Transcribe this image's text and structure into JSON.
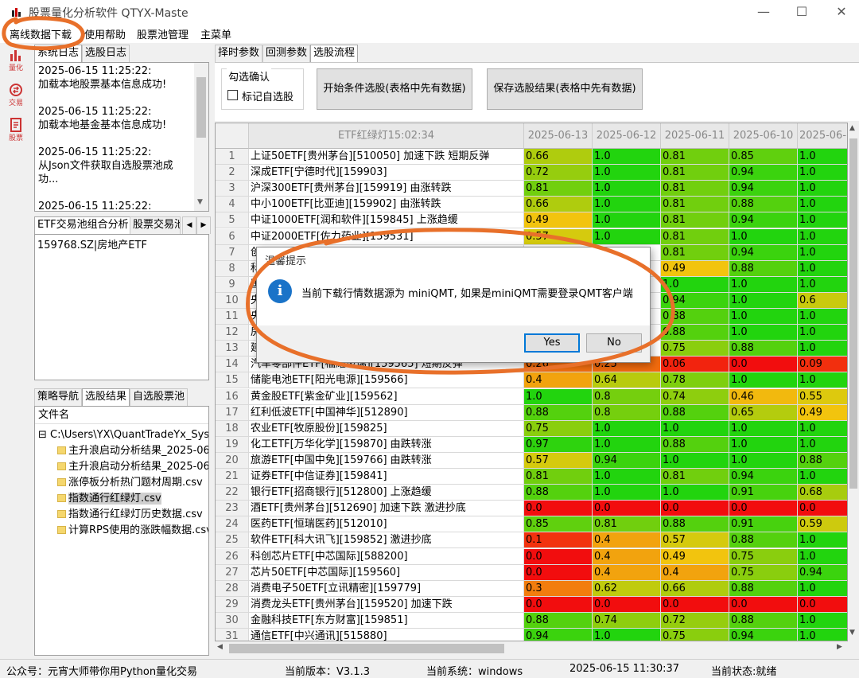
{
  "window": {
    "title": "股票量化分析软件 QTYX-Maste",
    "minimize": "—",
    "maximize": "☐",
    "close": "✕"
  },
  "menubar": {
    "items": [
      "离线数据下载",
      "使用帮助",
      "股票池管理",
      "主菜单"
    ]
  },
  "leftstrip": {
    "items": [
      {
        "label": "量化",
        "icon": "bar-chart-icon"
      },
      {
        "label": "交易",
        "icon": "exchange-icon"
      },
      {
        "label": "股票",
        "icon": "document-icon"
      }
    ]
  },
  "log_panel": {
    "tabs": [
      "系统日志",
      "选股日志"
    ],
    "text": "2025-06-15 11:25:22:\n加载本地股票基本信息成功!\n\n2025-06-15 11:25:22:\n加载本地基金基本信息成功!\n\n2025-06-15 11:25:22:\n从Json文件获取自选股票池成功...\n\n2025-06-15 11:25:22:"
  },
  "etf_panel": {
    "tabs": [
      "ETF交易池组合分析",
      "股票交易池"
    ],
    "items": [
      "159768.SZ|房地产ETF"
    ],
    "arrow_left": "◀",
    "arrow_right": "▶"
  },
  "strategy_panel": {
    "tabs": [
      "策略导航",
      "选股结果",
      "自选股票池"
    ],
    "column_header": "文件名",
    "root": "C:\\Users\\YX\\QuantTradeYx_System",
    "expander": "⊟",
    "files": [
      "主升浪启动分析结果_2025-06",
      "主升浪启动分析结果_2025-06",
      "涨停板分析热门题材周期.csv",
      "指数通行红绿灯.csv",
      "指数通行红绿灯历史数据.csv",
      "计算RPS使用的涨跌幅数据.csv"
    ],
    "selected_index": 3
  },
  "right_tabs": [
    "择时参数",
    "回测参数",
    "选股流程"
  ],
  "controls": {
    "group_title": "勾选确认",
    "checkbox_label": "标记自选股",
    "checkbox_checked": false,
    "btn_start": "开始条件选股(表格中先有数据)",
    "btn_save": "保存选股结果(表格中先有数据)"
  },
  "table": {
    "header_name": "ETF红绿灯15:02:34",
    "dates": [
      "2025-06-13",
      "2025-06-12",
      "2025-06-11",
      "2025-06-10",
      "2025-06-"
    ],
    "rows": [
      {
        "n": "1",
        "name": "上证50ETF[贵州茅台][510050] 加速下跌 短期反弹",
        "v": [
          "0.66",
          "1.0",
          "0.81",
          "0.85",
          "1.0"
        ]
      },
      {
        "n": "2",
        "name": "深成ETF[宁德时代][159903]",
        "v": [
          "0.72",
          "1.0",
          "0.81",
          "0.94",
          "1.0"
        ]
      },
      {
        "n": "3",
        "name": "沪深300ETF[贵州茅台][159919] 由涨转跌",
        "v": [
          "0.81",
          "1.0",
          "0.81",
          "0.94",
          "1.0"
        ]
      },
      {
        "n": "4",
        "name": "中小100ETF[比亚迪][159902] 由涨转跌",
        "v": [
          "0.66",
          "1.0",
          "0.81",
          "0.88",
          "1.0"
        ]
      },
      {
        "n": "5",
        "name": "中证1000ETF[润和软件][159845] 上涨趋缓",
        "v": [
          "0.49",
          "1.0",
          "0.81",
          "0.94",
          "1.0"
        ]
      },
      {
        "n": "6",
        "name": "中证2000ETF[佐力药业][159531]",
        "v": [
          "0.57",
          "1.0",
          "0.81",
          "1.0",
          "1.0"
        ]
      },
      {
        "n": "7",
        "name": "创",
        "v": [
          "",
          "",
          "0.81",
          "0.94",
          "1.0"
        ]
      },
      {
        "n": "8",
        "name": "科",
        "v": [
          "",
          "",
          "0.49",
          "0.88",
          "1.0"
        ]
      },
      {
        "n": "9",
        "name": "国",
        "v": [
          "",
          "",
          "1.0",
          "1.0",
          "1.0"
        ]
      },
      {
        "n": "10",
        "name": "央",
        "v": [
          "",
          "",
          "0.94",
          "1.0",
          "0.6"
        ]
      },
      {
        "n": "11",
        "name": "央",
        "v": [
          "",
          "",
          "0.88",
          "1.0",
          "1.0"
        ]
      },
      {
        "n": "12",
        "name": "房",
        "v": [
          "",
          "",
          "0.88",
          "1.0",
          "1.0"
        ]
      },
      {
        "n": "13",
        "name": "建",
        "v": [
          "",
          "",
          "0.75",
          "0.88",
          "1.0"
        ]
      },
      {
        "n": "14",
        "name": "汽车零部件ETF[福耀玻璃][159565] 短期反弹",
        "v": [
          "0.26",
          "0.25",
          "0.06",
          "0.0",
          "0.09"
        ]
      },
      {
        "n": "15",
        "name": "储能电池ETF[阳光电源][159566]",
        "v": [
          "0.4",
          "0.64",
          "0.78",
          "1.0",
          "1.0"
        ]
      },
      {
        "n": "16",
        "name": "黄金股ETF[紫金矿业][159562]",
        "v": [
          "1.0",
          "0.8",
          "0.74",
          "0.46",
          "0.55"
        ]
      },
      {
        "n": "17",
        "name": "红利低波ETF[中国神华][512890]",
        "v": [
          "0.88",
          "0.8",
          "0.88",
          "0.65",
          "0.49"
        ]
      },
      {
        "n": "18",
        "name": "农业ETF[牧原股份][159825]",
        "v": [
          "0.75",
          "1.0",
          "1.0",
          "1.0",
          "1.0"
        ]
      },
      {
        "n": "19",
        "name": "化工ETF[万华化学][159870] 由跌转涨",
        "v": [
          "0.97",
          "1.0",
          "0.88",
          "1.0",
          "1.0"
        ]
      },
      {
        "n": "20",
        "name": "旅游ETF[中国中免][159766] 由跌转涨",
        "v": [
          "0.57",
          "0.94",
          "1.0",
          "1.0",
          "0.88"
        ]
      },
      {
        "n": "21",
        "name": "证券ETF[中信证券][159841]",
        "v": [
          "0.81",
          "1.0",
          "0.81",
          "0.94",
          "1.0"
        ]
      },
      {
        "n": "22",
        "name": "银行ETF[招商银行][512800] 上涨趋缓",
        "v": [
          "0.88",
          "1.0",
          "1.0",
          "0.91",
          "0.68"
        ]
      },
      {
        "n": "23",
        "name": "酒ETF[贵州茅台][512690] 加速下跌 激进抄底",
        "v": [
          "0.0",
          "0.0",
          "0.0",
          "0.0",
          "0.0"
        ]
      },
      {
        "n": "24",
        "name": "医药ETF[恒瑞医药][512010]",
        "v": [
          "0.85",
          "0.81",
          "0.88",
          "0.91",
          "0.59"
        ]
      },
      {
        "n": "25",
        "name": "软件ETF[科大讯飞][159852] 激进抄底",
        "v": [
          "0.1",
          "0.4",
          "0.57",
          "0.88",
          "1.0"
        ]
      },
      {
        "n": "26",
        "name": "科创芯片ETF[中芯国际][588200]",
        "v": [
          "0.0",
          "0.4",
          "0.49",
          "0.75",
          "1.0"
        ]
      },
      {
        "n": "27",
        "name": "芯片50ETF[中芯国际][159560]",
        "v": [
          "0.0",
          "0.4",
          "0.4",
          "0.75",
          "0.94"
        ]
      },
      {
        "n": "28",
        "name": "消费电子50ETF[立讯精密][159779]",
        "v": [
          "0.3",
          "0.62",
          "0.66",
          "0.88",
          "1.0"
        ]
      },
      {
        "n": "29",
        "name": "消费龙头ETF[贵州茅台][159520] 加速下跌",
        "v": [
          "0.0",
          "0.0",
          "0.0",
          "0.0",
          "0.0"
        ]
      },
      {
        "n": "30",
        "name": "金融科技ETF[东方财富][159851]",
        "v": [
          "0.88",
          "0.74",
          "0.72",
          "0.88",
          "1.0"
        ]
      },
      {
        "n": "31",
        "name": "通信ETF[中兴通讯][515880]",
        "v": [
          "0.94",
          "1.0",
          "0.75",
          "0.94",
          "1.0"
        ]
      }
    ]
  },
  "dialog": {
    "title": "温馨提示",
    "icon": "i",
    "message": "当前下载行情数据源为 miniQMT, 如果是miniQMT需要登录QMT客户端",
    "yes": "Yes",
    "no": "No"
  },
  "statusbar": {
    "public": "公众号：元宵大师带你用Python量化交易",
    "version": "当前版本：V3.1.3",
    "system": "当前系统：windows",
    "time": "2025-06-15 11:30:37",
    "state": "当前状态:就绪"
  },
  "scroll": {
    "up": "▲",
    "down": "▼",
    "left": "◀",
    "right": "▶"
  },
  "colors": {
    "highlight_orange": "#e8702a",
    "cell_green": "#22d40e",
    "cell_red": "#f20d0d",
    "dialog_icon": "#1a73c8"
  }
}
